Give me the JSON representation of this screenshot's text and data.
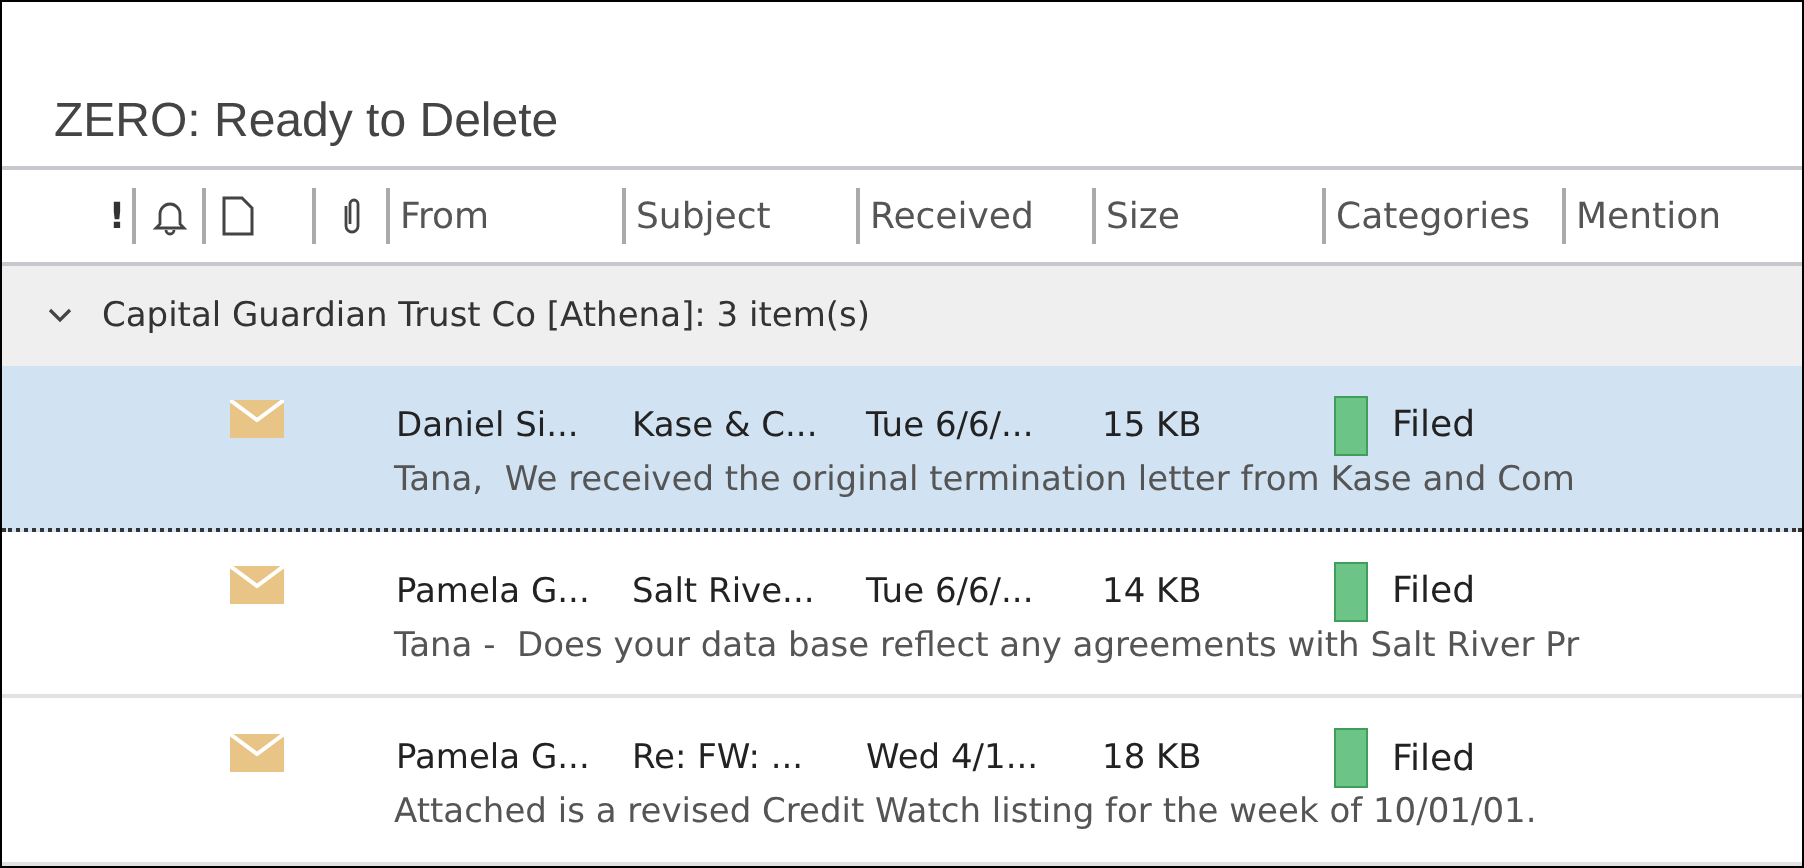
{
  "folder_title": "ZERO: Ready to Delete",
  "columns": [
    "!",
    "From",
    "Subject",
    "Received",
    "Size",
    "Categories",
    "Mention"
  ],
  "group": {
    "label": "Capital Guardian Trust Co [Athena]: 3 item(s)",
    "expanded": true
  },
  "messages": [
    {
      "from": "Daniel Si...",
      "subject": "Kase & C...",
      "received": "Tue 6/6/...",
      "size": "15 KB",
      "category": "Filed",
      "color": "#6cc486",
      "preview": "Tana,  We received the original termination letter from Kase and Com",
      "selected": true
    },
    {
      "from": "Pamela G...",
      "subject": "Salt Rive...",
      "received": "Tue 6/6/...",
      "size": "14 KB",
      "category": "Filed",
      "color": "#6cc486",
      "preview": "Tana -  Does your data base reflect any agreements with Salt River Pr",
      "selected": false
    },
    {
      "from": "Pamela G...",
      "subject": "Re: FW: ...",
      "received": "Wed 4/1...",
      "size": "18 KB",
      "category": "Filed",
      "color": "#6cc486",
      "preview": "Attached is a revised Credit Watch listing for the week of 10/01/01.",
      "selected": false
    }
  ]
}
